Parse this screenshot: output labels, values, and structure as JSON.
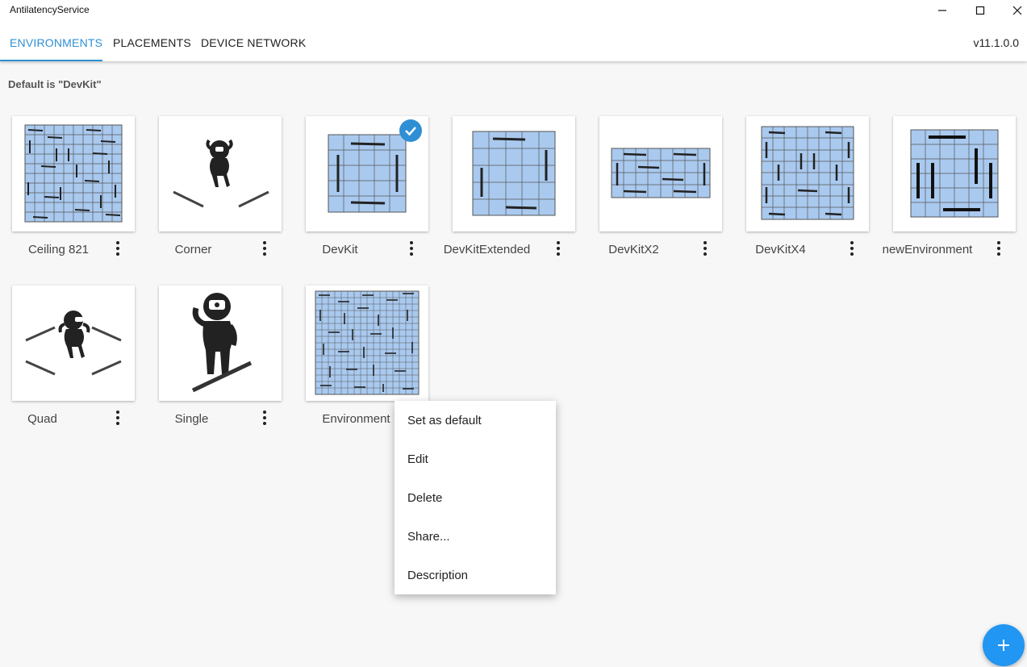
{
  "window": {
    "title": "AntilatencyService",
    "controls": [
      "minimize-icon",
      "maximize-icon",
      "close-icon"
    ]
  },
  "tabs": [
    {
      "label": "ENVIRONMENTS",
      "active": true
    },
    {
      "label": "PLACEMENTS",
      "active": false
    },
    {
      "label": "DEVICE NETWORK",
      "active": false
    }
  ],
  "version": "v11.1.0.0",
  "default_note": "Default is \"DevKit\"",
  "environments": [
    {
      "name": "Ceiling 821",
      "thumbnail": "dense-grid-map",
      "is_default": false
    },
    {
      "name": "Corner",
      "thumbnail": "person-two-bars-icon",
      "is_default": false
    },
    {
      "name": "DevKit",
      "thumbnail": "square-grid-map",
      "is_default": true
    },
    {
      "name": "DevKitExtended",
      "thumbnail": "tall-grid-map",
      "is_default": false
    },
    {
      "name": "DevKitX2",
      "thumbnail": "wide-grid-map",
      "is_default": false
    },
    {
      "name": "DevKitX4",
      "thumbnail": "large-grid-map",
      "is_default": false
    },
    {
      "name": "newEnvironment",
      "thumbnail": "bars-grid-map",
      "is_default": false
    },
    {
      "name": "Quad",
      "thumbnail": "person-four-bars-icon",
      "is_default": false
    },
    {
      "name": "Single",
      "thumbnail": "person-single-bar-icon",
      "is_default": false
    },
    {
      "name": "Environment",
      "thumbnail": "very-dense-grid-map",
      "is_default": false
    }
  ],
  "context_menu": {
    "items": [
      "Set as default",
      "Edit",
      "Delete",
      "Share...",
      "Description"
    ]
  },
  "fab": {
    "icon": "plus-icon"
  },
  "colors": {
    "accent": "#2f8fd4",
    "fab": "#2196f3",
    "grid_fill": "#a9c9ef",
    "grid_line": "#555555"
  }
}
